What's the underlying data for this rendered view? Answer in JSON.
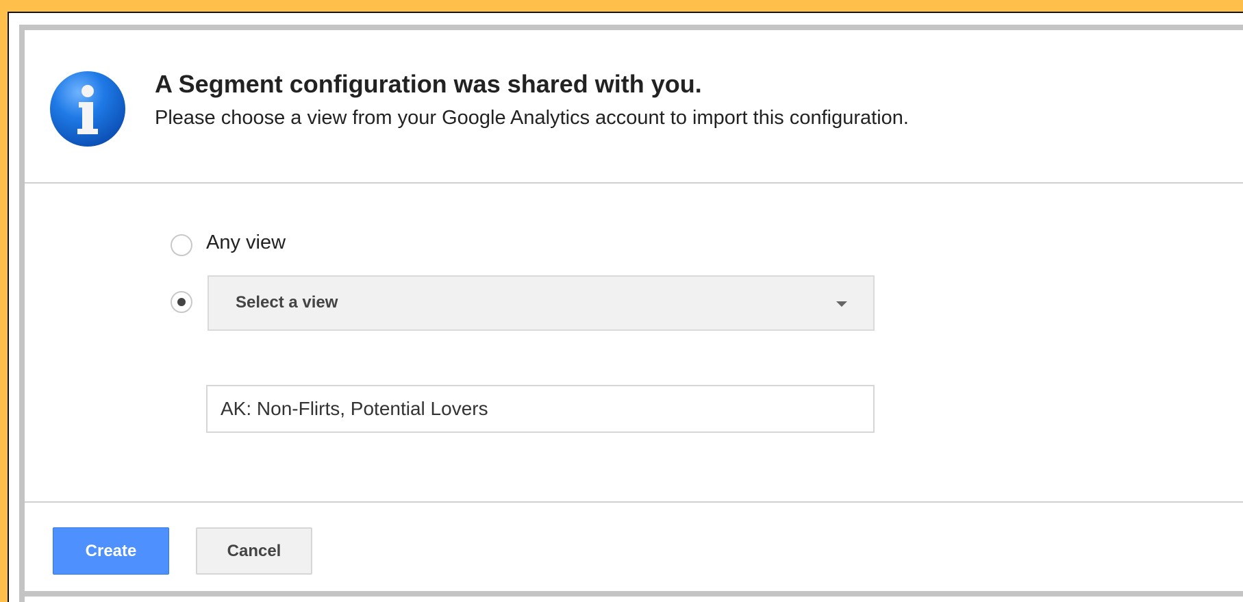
{
  "dialog": {
    "title": "A Segment configuration was shared with you.",
    "subtitle": "Please choose a view from your Google Analytics account to import this configuration."
  },
  "options": {
    "any_view_label": "Any view",
    "any_view_selected": false,
    "select_view_selected": true,
    "select_view_value": "Select a view"
  },
  "segment_name_input": {
    "value": "AK: Non-Flirts, Potential Lovers"
  },
  "buttons": {
    "create_label": "Create",
    "cancel_label": "Cancel"
  },
  "colors": {
    "frame_border": "#ffbf4b",
    "dialog_border": "#c4c4c4",
    "primary_button": "#4d90fe",
    "info_icon": "#1a73e8"
  },
  "icons": {
    "info": "info-icon",
    "dropdown": "chevron-down-icon"
  }
}
